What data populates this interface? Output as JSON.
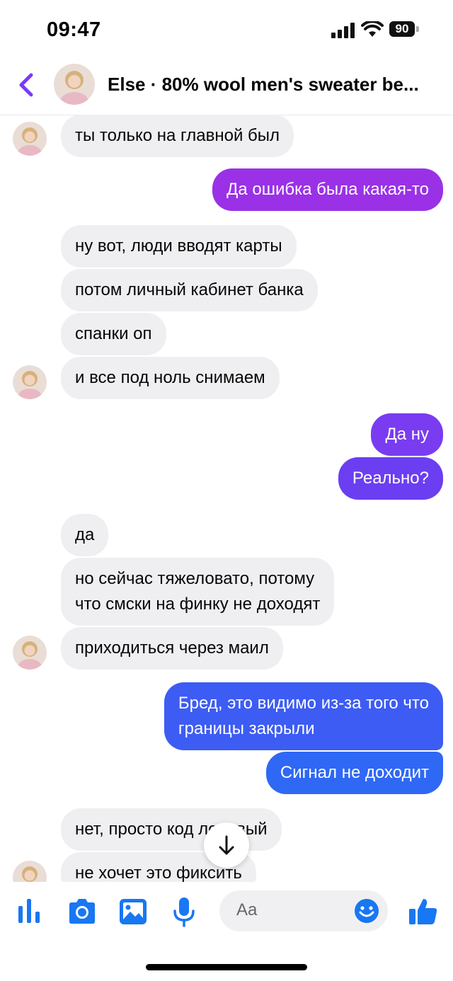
{
  "status_bar": {
    "time": "09:47",
    "battery": "90"
  },
  "header": {
    "title": "Else · 80% wool men's sweater be..."
  },
  "messages": [
    {
      "text": "ты только на главной был"
    },
    {
      "text": "Да ошибка была какая-то"
    },
    {
      "text": "ну вот, люди вводят карты"
    },
    {
      "text": "потом личный кабинет банка"
    },
    {
      "text": "спанки оп"
    },
    {
      "text": "и все под ноль снимаем"
    },
    {
      "text": "Да ну"
    },
    {
      "text": "Реально?"
    },
    {
      "text": "да"
    },
    {
      "text": "но сейчас тяжеловато, потому\nчто смски на финку не доходят"
    },
    {
      "text": "приходиться через маил"
    },
    {
      "text": "Бред, это видимо из-за того что\nграницы закрыли"
    },
    {
      "text": "Сигнал не доходит"
    },
    {
      "text": "нет, просто код ленивый"
    },
    {
      "text": "не хочет это фиксить"
    }
  ],
  "composer": {
    "placeholder": "Aa"
  },
  "colors": {
    "accent": "#7a3cf5",
    "outgoing_gradient": [
      "#a42ee0",
      "#8a36e8",
      "#6b3df0",
      "#4f46f2",
      "#3a5df5",
      "#2d6ef5"
    ],
    "incoming": "#efeff1",
    "icon_blue": "#1877f2"
  },
  "icons": [
    "back-arrow-icon",
    "signal-icon",
    "wifi-icon",
    "battery-icon",
    "audio-bars-icon",
    "camera-icon",
    "image-icon",
    "microphone-icon",
    "emoji-icon",
    "thumbs-up-icon",
    "arrow-down-icon"
  ]
}
